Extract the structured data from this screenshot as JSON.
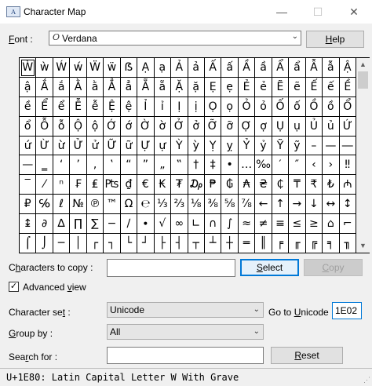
{
  "window": {
    "title": "Character Map",
    "icon_text": "A",
    "minimize": "—",
    "maximize": "☐",
    "close": "✕"
  },
  "font": {
    "label_prefix": "",
    "label_ul": "F",
    "label_rest": "ont :",
    "icon_glyph": "O",
    "value": "Verdana",
    "arrow": "⌄"
  },
  "help_button": {
    "ul": "H",
    "rest": "elp"
  },
  "grid": {
    "selected_index": 0,
    "chars": [
      "Ẁ",
      "ẁ",
      "Ẃ",
      "ẃ",
      "Ẅ",
      "ẅ",
      "ẞ",
      "Ạ",
      "ạ",
      "Ả",
      "ả",
      "Ấ",
      "ấ",
      "Ầ",
      "ầ",
      "Ẩ",
      "ẩ",
      "Ẫ",
      "ẫ",
      "Ậ",
      "ậ",
      "Ắ",
      "ắ",
      "Ằ",
      "ằ",
      "Ẳ",
      "ẳ",
      "Ẵ",
      "ẵ",
      "Ặ",
      "ặ",
      "Ẹ",
      "ẹ",
      "Ẻ",
      "ẻ",
      "Ẽ",
      "ẽ",
      "Ế",
      "ế",
      "Ề",
      "ề",
      "Ể",
      "ể",
      "Ễ",
      "ễ",
      "Ệ",
      "ệ",
      "Ỉ",
      "ỉ",
      "Ị",
      "ị",
      "Ọ",
      "ọ",
      "Ỏ",
      "ỏ",
      "Ố",
      "ố",
      "Ồ",
      "ồ",
      "Ổ",
      "ổ",
      "Ỗ",
      "ỗ",
      "Ộ",
      "ộ",
      "Ớ",
      "ớ",
      "Ờ",
      "ờ",
      "Ở",
      "ở",
      "Ỡ",
      "ỡ",
      "Ợ",
      "ợ",
      "Ụ",
      "ụ",
      "Ủ",
      "ủ",
      "Ứ",
      "ứ",
      "Ừ",
      "ừ",
      "Ử",
      "ử",
      "Ữ",
      "ữ",
      "Ự",
      "ự",
      "Ỳ",
      "ỳ",
      "Ỵ",
      "ỵ",
      "Ỷ",
      "ỷ",
      "Ỹ",
      "ỹ",
      "–",
      "—",
      "―",
      "—",
      "‗",
      "‘",
      "’",
      "‚",
      "‛",
      "“",
      "”",
      "„",
      "‟",
      "†",
      "‡",
      "•",
      "…",
      "‰",
      "′",
      "″",
      "‹",
      "›",
      "‼",
      "‾",
      "⁄",
      "ⁿ",
      "₣",
      "₤",
      "₧",
      "₫",
      "€",
      "₭",
      "₮",
      "₯",
      "₱",
      "₲",
      "₳",
      "₴",
      "₵",
      "₸",
      "₹",
      "₺",
      "₼",
      "₽",
      "℅",
      "ℓ",
      "№",
      "℗",
      "™",
      "Ω",
      "℮",
      "⅓",
      "⅔",
      "⅛",
      "⅜",
      "⅝",
      "⅞",
      "←",
      "↑",
      "→",
      "↓",
      "↔",
      "↕",
      "↨",
      "∂",
      "∆",
      "∏",
      "∑",
      "−",
      "∕",
      "∙",
      "√",
      "∞",
      "∟",
      "∩",
      "∫",
      "≈",
      "≠",
      "≡",
      "≤",
      "≥",
      "⌂",
      "⌐",
      "⌠",
      "⌡",
      "─",
      "│",
      "┌",
      "┐",
      "└",
      "┘",
      "├",
      "┤",
      "┬",
      "┴",
      "┼",
      "═",
      "║",
      "╒",
      "╓",
      "╔",
      "╕",
      "╖"
    ]
  },
  "chars_to_copy": {
    "ul": "h",
    "pre": "C",
    "rest": "aracters to copy :",
    "value": ""
  },
  "select_button": {
    "ul": "S",
    "rest": "elect"
  },
  "copy_button": {
    "ul": "C",
    "rest": "opy"
  },
  "advanced_view": {
    "ul": "v",
    "pre": "Advanced ",
    "rest": "iew",
    "checked": "✓"
  },
  "character_set": {
    "pre": "Character se",
    "ul": "t",
    "rest": " :",
    "value": "Unicode",
    "arrow": "⌄"
  },
  "goto_unicode": {
    "pre": "Go to ",
    "ul": "U",
    "rest": "nicode :",
    "value": "1E02"
  },
  "group_by": {
    "ul": "G",
    "rest": "roup by :",
    "value": "All",
    "arrow": "⌄"
  },
  "search_for": {
    "pre": "Sea",
    "ul": "r",
    "rest": "ch for :",
    "value": ""
  },
  "reset_button": {
    "ul": "R",
    "rest": "eset"
  },
  "status": {
    "text": "U+1E80: Latin Capital Letter W With Grave",
    "grip": "⋰"
  }
}
